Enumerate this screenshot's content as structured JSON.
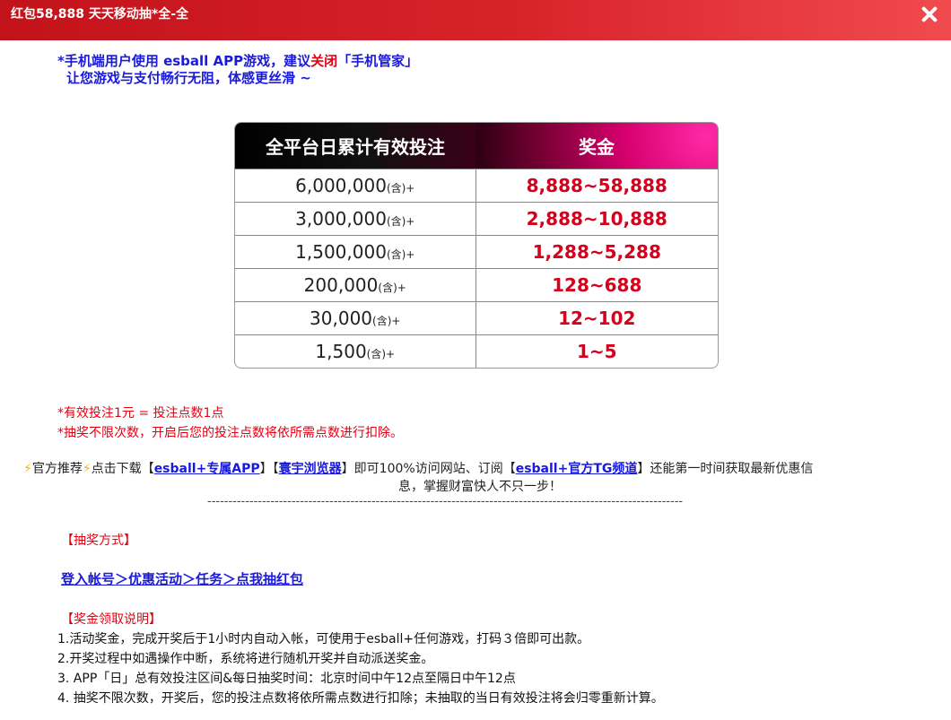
{
  "header": {
    "title": "红包58,888 天天移动抽*全-全"
  },
  "notice": {
    "line1_a": "*手机端用户使用 esball APP游戏，建议",
    "line1_red": "关闭",
    "line1_b": "「手机管家」",
    "line2": "让您游戏与支付畅行无阻，体感更丝滑 ~"
  },
  "table": {
    "headers": [
      "全平台日累计有效投注",
      "奖金"
    ],
    "suffix": "(含)+",
    "rows": [
      {
        "amount": "6,000,000",
        "prize": "8,888~58,888"
      },
      {
        "amount": "3,000,000",
        "prize": "2,888~10,888"
      },
      {
        "amount": "1,500,000",
        "prize": "1,288~5,288"
      },
      {
        "amount": "200,000",
        "prize": "128~688"
      },
      {
        "amount": "30,000",
        "prize": "12~102"
      },
      {
        "amount": "1,500",
        "prize": "1~5"
      }
    ]
  },
  "rules": {
    "line1": "*有效投注1元 = 投注点数1点",
    "line2": "*抽奖不限次数，开启后您的投注点数将依所需点数进行扣除。"
  },
  "promo": {
    "bolt": "⚡",
    "rec": "官方推荐",
    "download": "点击下载",
    "open": "【",
    "close": "】",
    "link_app": "esball+专属APP",
    "link_browser": "寰宇浏览器",
    "mid": "即可100%访问网站、订阅",
    "link_tg": "esball+官方TG频道",
    "tail": "还能第一时间获取最新优惠信",
    "line2": "息，掌握财富快人不只一步！"
  },
  "divider": "-----------------------------------------------------------------------------------------------------------------",
  "method": {
    "title": "【抽奖方式】",
    "path": "登入帐号＞优惠活动＞任务＞点我抽红包"
  },
  "claim": {
    "title": "【奖金领取说明】",
    "items": [
      "1.活动奖金，完成开奖后于1小时内自动入帐，可使用于esball+任何游戏，打码３倍即可出款。",
      "2.开奖过程中如遇操作中断，系统将进行随机开奖并自动派送奖金。",
      "3. APP「日」总有效投注区间&每日抽奖时间：北京时间中午12点至隔日中午12点",
      "4. 抽奖不限次数，开奖后，您的投注点数将依所需点数进行扣除；未抽取的当日有效投注将会归零重新计算。"
    ]
  },
  "colors": {
    "header_red": "#d9232b",
    "link_blue": "#1a1adb",
    "prize_red": "#d4001c"
  }
}
